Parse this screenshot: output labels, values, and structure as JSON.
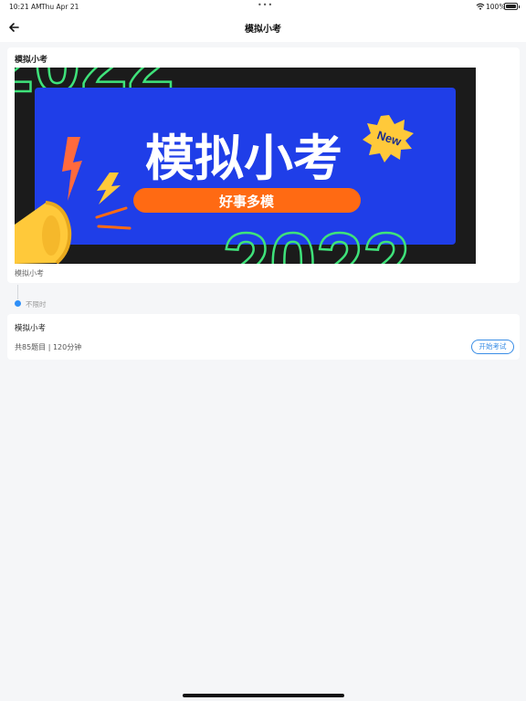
{
  "status_bar": {
    "time": "10:21 AM",
    "day": "Thu Apr 21",
    "battery": "100%"
  },
  "nav": {
    "title": "模拟小考"
  },
  "exam_card": {
    "section_title": "模拟小考",
    "banner": {
      "headline": "模拟小考",
      "tagline": "好事多模",
      "badge": "New",
      "year_text": "2022"
    },
    "caption": "模拟小考"
  },
  "timeline": {
    "label": "不限时"
  },
  "exam_item": {
    "name": "模拟小考",
    "meta": "共85题目 | 120分钟",
    "start_label": "开始考试"
  },
  "colors": {
    "accent": "#3a8ee6",
    "banner_blue": "#1f3ee8",
    "banner_orange": "#ff6a13",
    "badge_yellow": "#ffc93a",
    "stripe_green": "#3fe27a"
  }
}
